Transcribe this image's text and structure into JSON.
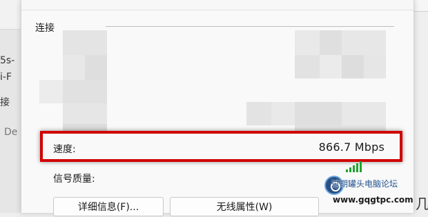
{
  "background_window": {
    "fragments": [
      "5s-",
      "i-F",
      "接",
      "De"
    ]
  },
  "dialog": {
    "group_title": "连接",
    "speed": {
      "label": "速度:",
      "value": "866.7 Mbps"
    },
    "signal": {
      "label": "信号质量:",
      "icon": "signal-bars-icon",
      "bars_active": 5,
      "bars_total": 5
    },
    "buttons": {
      "details": "详细信息(F)...",
      "wireless_properties": "无线属性(W)"
    },
    "highlight_color": "#d10000"
  },
  "watermark": {
    "text": "过期罐头电脑论坛",
    "url": "www.gqgtpc.com",
    "trailing_char": "几"
  }
}
